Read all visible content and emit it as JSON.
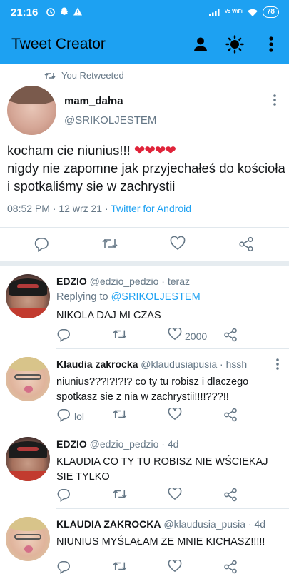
{
  "status_bar": {
    "time": "21:16",
    "network": "Vo WiFi",
    "battery": "78"
  },
  "app_bar": {
    "title": "Tweet Creator"
  },
  "main_tweet": {
    "retweet_label": "You Retweeted",
    "display_name": "mam_dałna",
    "handle": "@SRIKOLJESTEM",
    "text_line1": "kocham cie niunius!!!",
    "hearts": "❤❤❤❤",
    "text_line2": "nigdy nie zapomne jak przyjechałeś do kościoła i spotkaliśmy sie w zachrystii",
    "timestamp": "08:52 PM · 12 wrz 21 · ",
    "source": "Twitter for Android"
  },
  "replies": [
    {
      "name": "EDZIO",
      "handle": "@edzio_pedzio",
      "time": "teraz",
      "replying_prefix": "Replying to ",
      "replying_to": "@SRIKOLJESTEM",
      "text": "NIKOLA DAJ MI CZAS",
      "like_count": "2000"
    },
    {
      "name": "Klaudia zakrocka",
      "handle": "@klaudusiapusia",
      "time": "hssh",
      "text": "niunius???!?!?!? co ty tu robisz i dlaczego spotkasz sie z nia w zachrystii!!!!???!!",
      "reply_count": "lol"
    },
    {
      "name": "EDZIO",
      "handle": "@edzio_pedzio",
      "time": "4d",
      "text": "KLAUDIA CO TY TU ROBISZ NIE WŚCIEKAJ SIE TYLKO"
    },
    {
      "name": "KLAUDIA ZAKROCKA",
      "handle": "@klaudusia_pusia",
      "time": "4d",
      "text": "NIUNIUS MYŚLAŁAM ZE MNIE KICHASZ!!!!!"
    }
  ],
  "colors": {
    "accent": "#1da1f2",
    "secondary_text": "#657786",
    "divider": "#e1e8ed",
    "heart": "#e0243a"
  }
}
